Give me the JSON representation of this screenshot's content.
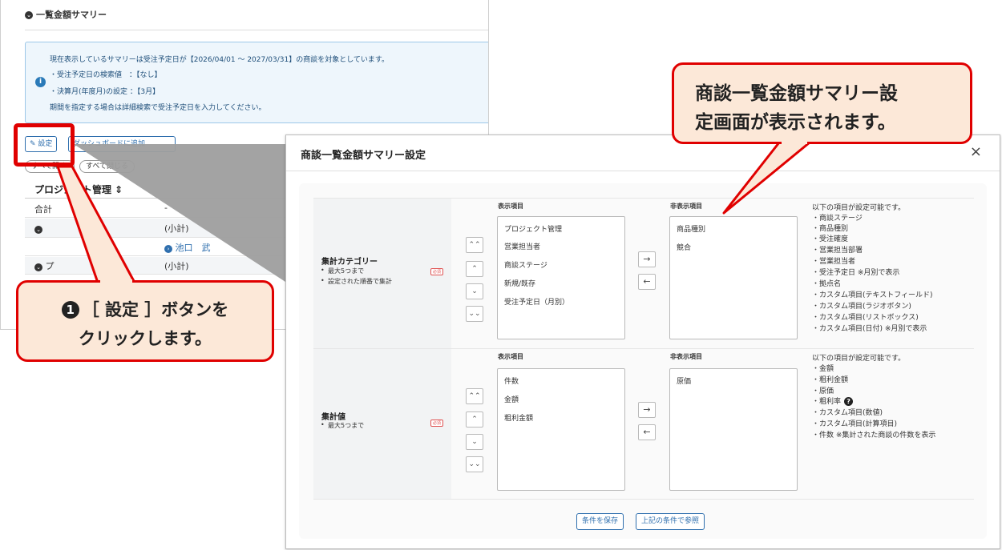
{
  "background_page": {
    "section_title": "一覧金額サマリー",
    "info": {
      "line1": "現在表示しているサマリーは受注予定日が【2026/04/01 ～ 2027/03/31】の商談を対象としています。",
      "line2": "・受注予定日の検索値　：【なし】",
      "line3": "・決算月(年度月)の設定 ：【3月】",
      "line4": "期間を指定する場合は詳細検索で受注予定日を入力してください。"
    },
    "settings_button": "設定",
    "second_button": "ダッシュボードに追加",
    "pill_left": "すべて開く",
    "pill_right": "すべて閉じる",
    "table": {
      "header": "プロジェクト管理 ⇕",
      "rows": [
        {
          "c1": "合計",
          "c2": "-"
        },
        {
          "c1": "",
          "c2": "(小計)"
        },
        {
          "c1": "",
          "c2": "池口　武"
        },
        {
          "c1": "プ",
          "c2": "(小計)"
        }
      ]
    }
  },
  "modal": {
    "title": "商談一覧金額サマリー設定",
    "close": "×",
    "required_badge": "必須",
    "category": {
      "name": "集計カテゴリー",
      "notes": [
        "最大5つまで",
        "設定された順番で集計"
      ],
      "shown_header": "表示項目",
      "hidden_header": "非表示項目",
      "shown_items": [
        "プロジェクト管理",
        "営業担当者",
        "商談ステージ",
        "新規/既存",
        "受注予定日（月別）"
      ],
      "hidden_items": [
        "商品種別",
        "競合"
      ],
      "available_title": "以下の項目が設定可能です。",
      "available_items": [
        "・商談ステージ",
        "・商品種別",
        "・受注確度",
        "・営業担当部署",
        "・営業担当者",
        "・受注予定日 ※月別で表示",
        "・拠点名",
        "・カスタム項目(テキストフィールド)",
        "・カスタム項目(ラジオボタン)",
        "・カスタム項目(リストボックス)",
        "・カスタム項目(日付) ※月別で表示"
      ]
    },
    "value": {
      "name": "集計値",
      "notes": [
        "最大5つまで"
      ],
      "shown_header": "表示項目",
      "hidden_header": "非表示項目",
      "shown_items": [
        "件数",
        "金額",
        "粗利金額"
      ],
      "hidden_items": [
        "原価"
      ],
      "available_title": "以下の項目が設定可能です。",
      "available_items": [
        "・金額",
        "・粗利金額",
        "・原価",
        "・粗利率",
        "・カスタム項目(数値)",
        "・カスタム項目(計算項目)",
        "・件数 ※集計された商談の件数を表示"
      ],
      "help_icon": "?"
    },
    "order_buttons": [
      "⌃⌃",
      "⌃",
      "⌄",
      "⌄⌄"
    ],
    "move_right": "→",
    "move_left": "←",
    "save_button": "条件を保存",
    "view_button": "上記の条件で参照"
  },
  "callouts": {
    "left_number": "1",
    "left_line1": "［ 設定 ］ボタンを",
    "left_line2": "クリックします。",
    "right_line1": "商談一覧金額サマリー設",
    "right_line2": "定画面が表示されます。"
  },
  "colors": {
    "accent": "#2f6fae",
    "callout_border": "#e00000",
    "callout_fill": "#fce8d8"
  }
}
